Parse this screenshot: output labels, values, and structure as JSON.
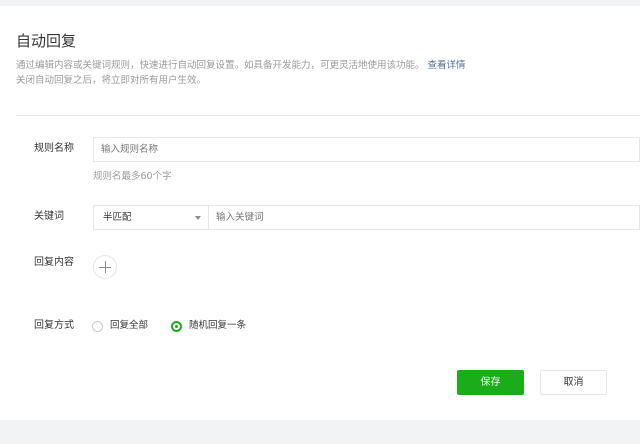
{
  "page": {
    "title": "自动回复",
    "description_line1": "通过编辑内容或关键词规则，快速进行自动回复设置。如具备开发能力，可更灵活地使用该功能。",
    "details_link": "查看详情",
    "description_line2": "关闭自动回复之后，将立即对所有用户生效。"
  },
  "form": {
    "rule_name": {
      "label": "规则名称",
      "placeholder": "输入规则名称",
      "hint": "规则名最多60个字"
    },
    "keyword": {
      "label": "关键词",
      "match_mode": "半匹配",
      "placeholder": "输入关键词"
    },
    "reply_content": {
      "label": "回复内容"
    },
    "reply_mode": {
      "label": "回复方式",
      "options": [
        {
          "label": "回复全部",
          "checked": false
        },
        {
          "label": "随机回复一条",
          "checked": true
        }
      ]
    }
  },
  "actions": {
    "save_label": "保存",
    "cancel_label": "取消"
  },
  "colors": {
    "primary": "#1aad19",
    "link": "#576b95",
    "muted_text": "#9a9a9a",
    "border": "#e4e8eb"
  }
}
